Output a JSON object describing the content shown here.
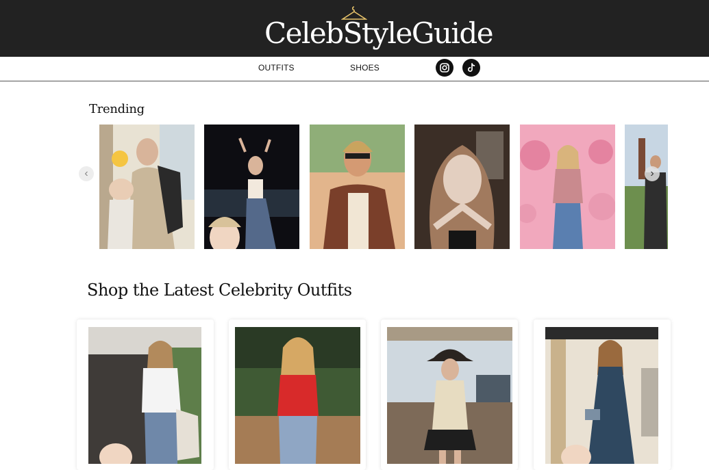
{
  "site": {
    "logo_text": "CelebStyleGuide"
  },
  "nav": {
    "links": [
      "OUTFITS",
      "SHOES"
    ],
    "social": [
      "instagram-icon",
      "tiktok-icon"
    ]
  },
  "trending": {
    "title": "Trending",
    "items": [
      {
        "name": "trending-photo-1",
        "colors": [
          "#c9b79a",
          "#e8e2d3",
          "#2a2a2a"
        ]
      },
      {
        "name": "trending-photo-2",
        "colors": [
          "#0d0d12",
          "#26303c",
          "#f2e9dd"
        ]
      },
      {
        "name": "trending-photo-3",
        "colors": [
          "#c97a42",
          "#e2b58c",
          "#7a3f2a"
        ]
      },
      {
        "name": "trending-photo-4",
        "colors": [
          "#3b2e26",
          "#a17a5e",
          "#e3cfc0"
        ]
      },
      {
        "name": "trending-photo-5",
        "colors": [
          "#f1a8bd",
          "#e483a0",
          "#5a7fb0"
        ]
      },
      {
        "name": "trending-photo-6",
        "colors": [
          "#6d8f4e",
          "#c7d6e3",
          "#2e2e2e"
        ]
      }
    ],
    "prev_icon": "chevron-left-icon",
    "next_icon": "chevron-right-icon"
  },
  "shop": {
    "title": "Shop the Latest Celebrity Outfits",
    "outfits": [
      {
        "name": "outfit-photo-1",
        "colors": [
          "#3f3b38",
          "#f4f4f4",
          "#6f88a9"
        ]
      },
      {
        "name": "outfit-photo-2",
        "colors": [
          "#3f5a34",
          "#d82a2a",
          "#8fa6c4"
        ]
      },
      {
        "name": "outfit-photo-3",
        "colors": [
          "#cfd8df",
          "#e7dcc1",
          "#2a2420"
        ]
      },
      {
        "name": "outfit-photo-4",
        "colors": [
          "#e9e1d3",
          "#2f4860",
          "#c9b28c"
        ]
      }
    ]
  }
}
